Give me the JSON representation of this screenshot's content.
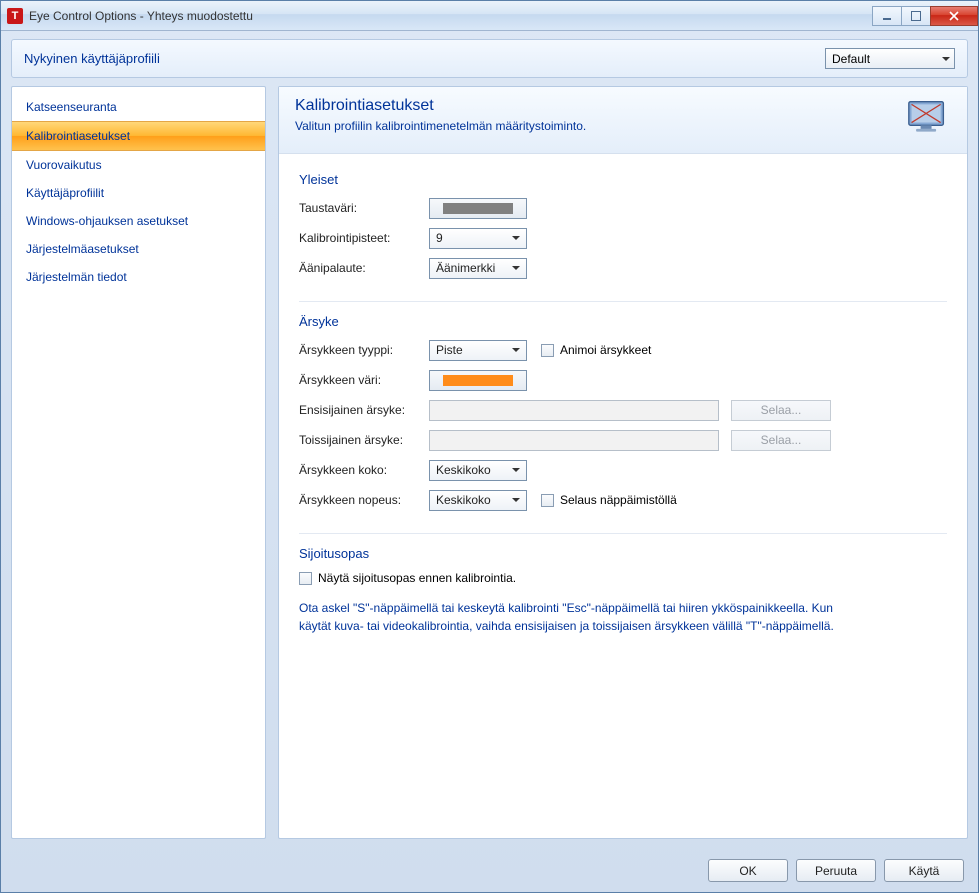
{
  "window": {
    "title": "Eye Control Options - Yhteys muodostettu",
    "icon_letter": "T"
  },
  "profile_bar": {
    "label": "Nykyinen käyttäjäprofiili",
    "selected": "Default"
  },
  "sidebar": {
    "items": [
      {
        "label": "Katseenseuranta",
        "active": false
      },
      {
        "label": "Kalibrointiasetukset",
        "active": true
      },
      {
        "label": "Vuorovaikutus",
        "active": false
      },
      {
        "label": "Käyttäjäprofiilit",
        "active": false
      },
      {
        "label": "Windows-ohjauksen asetukset",
        "active": false
      },
      {
        "label": "Järjestelmäasetukset",
        "active": false
      },
      {
        "label": "Järjestelmän tiedot",
        "active": false
      }
    ]
  },
  "content": {
    "title": "Kalibrointiasetukset",
    "subtitle": "Valitun profiilin kalibrointimenetelmän määritystoiminto."
  },
  "general": {
    "heading": "Yleiset",
    "background_label": "Taustaväri:",
    "background_color": "#808080",
    "points_label": "Kalibrointipisteet:",
    "points_value": "9",
    "sound_label": "Äänipalaute:",
    "sound_value": "Äänimerkki"
  },
  "stimulus": {
    "heading": "Ärsyke",
    "type_label": "Ärsykkeen tyyppi:",
    "type_value": "Piste",
    "animate_label": "Animoi ärsykkeet",
    "color_label": "Ärsykkeen väri:",
    "color_value": "#ff8c1a",
    "primary_label": "Ensisijainen ärsyke:",
    "primary_value": "",
    "secondary_label": "Toissijainen ärsyke:",
    "secondary_value": "",
    "browse_label": "Selaa...",
    "size_label": "Ärsykkeen koko:",
    "size_value": "Keskikoko",
    "speed_label": "Ärsykkeen nopeus:",
    "speed_value": "Keskikoko",
    "keyboard_step_label": "Selaus näppäimistöllä"
  },
  "placement": {
    "heading": "Sijoitusopas",
    "checkbox_label": "Näytä sijoitusopas ennen kalibrointia."
  },
  "help_text": "Ota askel \"S\"-näppäimellä tai keskeytä kalibrointi \"Esc\"-näppäimellä tai hiiren ykköspainikkeella. Kun käytät kuva- tai videokalibrointia, vaihda ensisijaisen ja toissijaisen ärsykkeen välillä \"T\"-näppäimellä.",
  "footer": {
    "ok": "OK",
    "cancel": "Peruuta",
    "apply": "Käytä"
  }
}
